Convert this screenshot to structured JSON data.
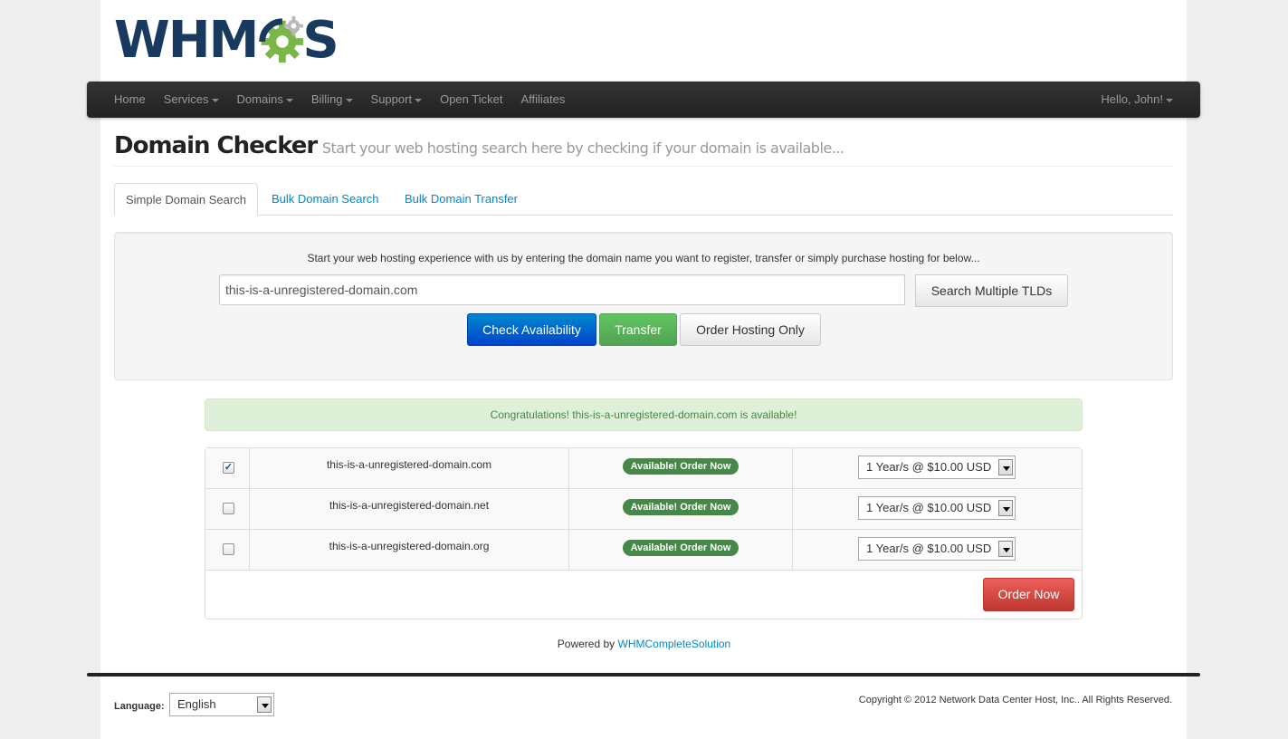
{
  "logo": {
    "text_left": "WHM",
    "text_right": "S",
    "alt": "WHMCS"
  },
  "nav": {
    "items": [
      {
        "label": "Home",
        "dropdown": false
      },
      {
        "label": "Services",
        "dropdown": true
      },
      {
        "label": "Domains",
        "dropdown": true
      },
      {
        "label": "Billing",
        "dropdown": true
      },
      {
        "label": "Support",
        "dropdown": true
      },
      {
        "label": "Open Ticket",
        "dropdown": false
      },
      {
        "label": "Affiliates",
        "dropdown": false
      }
    ],
    "user": "Hello, John!"
  },
  "header": {
    "title": "Domain Checker",
    "subtitle": "Start your web hosting search here by checking if your domain is available..."
  },
  "tabs": [
    {
      "label": "Simple Domain Search",
      "active": true
    },
    {
      "label": "Bulk Domain Search",
      "active": false
    },
    {
      "label": "Bulk Domain Transfer",
      "active": false
    }
  ],
  "search": {
    "intro": "Start your web hosting experience with us by entering the domain name you want to register, transfer or simply purchase hosting for below...",
    "domain_value": "this-is-a-unregistered-domain.com",
    "search_tlds_label": "Search Multiple TLDs",
    "check_label": "Check Availability",
    "transfer_label": "Transfer",
    "hosting_label": "Order Hosting Only"
  },
  "alert": {
    "message": "Congratulations! this-is-a-unregistered-domain.com is available!"
  },
  "results": {
    "rows": [
      {
        "checked": true,
        "domain": "this-is-a-unregistered-domain.com",
        "status": "Available! Order Now",
        "period": "1 Year/s @ $10.00 USD"
      },
      {
        "checked": false,
        "domain": "this-is-a-unregistered-domain.net",
        "status": "Available! Order Now",
        "period": "1 Year/s @ $10.00 USD"
      },
      {
        "checked": false,
        "domain": "this-is-a-unregistered-domain.org",
        "status": "Available! Order Now",
        "period": "1 Year/s @ $10.00 USD"
      }
    ],
    "order_label": "Order Now"
  },
  "footer": {
    "powered_prefix": "Powered by",
    "powered_link": "WHMCompleteSolution",
    "language_label": "Language:",
    "language_value": "English",
    "copyright": "Copyright © 2012 Network Data Center Host, Inc.. All Rights Reserved."
  },
  "colors": {
    "navbar": "#222222",
    "primary": "#0088cc",
    "success": "#468847",
    "danger": "#bd362f",
    "logo_blue": "#173a5e",
    "logo_green": "#7ab648"
  }
}
